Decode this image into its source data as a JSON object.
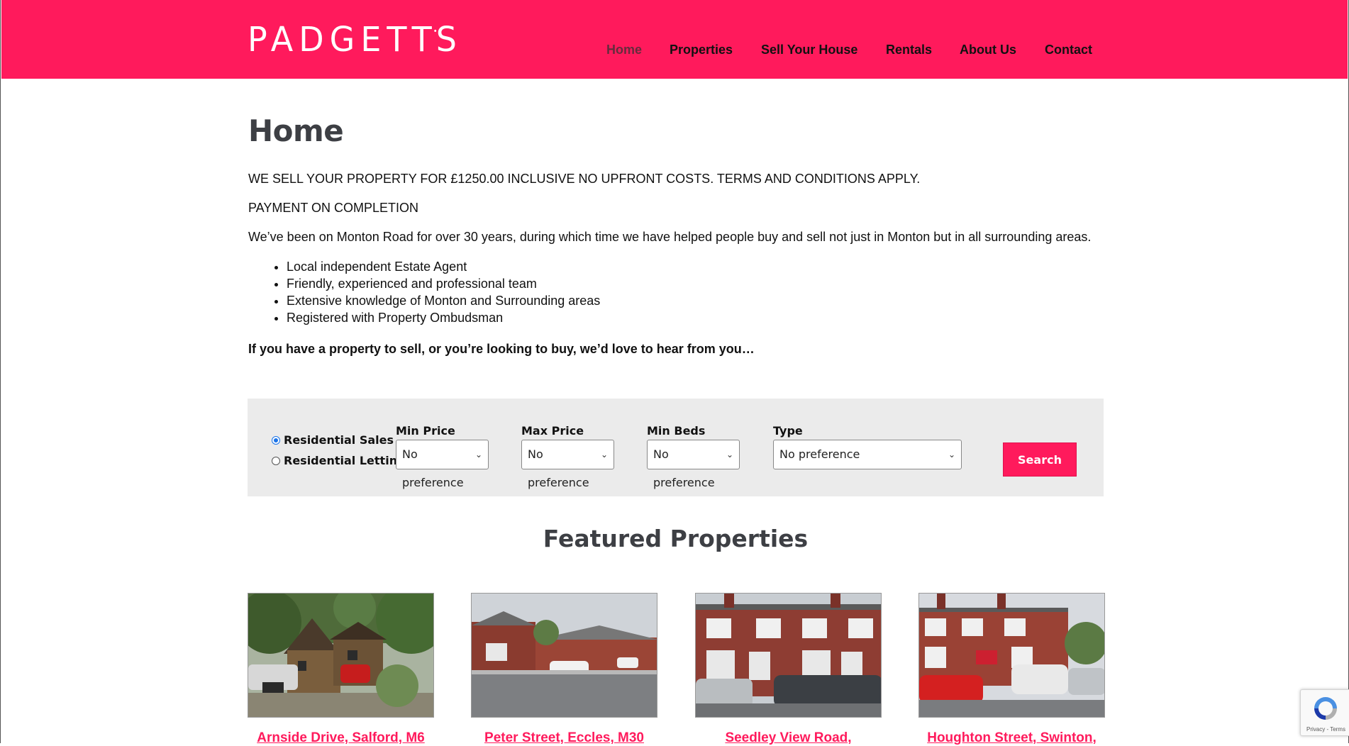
{
  "brand": {
    "logo_left": "PADGETT",
    "logo_dot": "•",
    "logo_right": "S",
    "accent": "#ff1a5c"
  },
  "nav": [
    {
      "label": "Home",
      "active": true
    },
    {
      "label": "Properties"
    },
    {
      "label": "Sell Your House"
    },
    {
      "label": "Rentals"
    },
    {
      "label": "About Us"
    },
    {
      "label": "Contact"
    }
  ],
  "page": {
    "title": "Home",
    "intro1": "WE SELL YOUR PROPERTY FOR £1250.00 INCLUSIVE NO UPFRONT COSTS. TERMS AND CONDITIONS APPLY.",
    "intro2": "PAYMENT ON COMPLETION",
    "intro3": "We’ve been on Monton Road for over 30 years, during which time we have helped people buy and sell not just in Monton but in all surrounding areas.",
    "bullets": [
      "Local independent Estate Agent",
      "Friendly, experienced and professional team",
      "Extensive knowledge of Monton and Surrounding areas",
      "Registered with Property Ombudsman"
    ],
    "cta": "If you have a property to sell, or you’re looking to buy, we’d love to hear from you…"
  },
  "search": {
    "radio_sales": "Residential Sales",
    "radio_lettings": "Residential Lettings",
    "selected": "sales",
    "min_price_label": "Min Price",
    "min_price_value": "No preference",
    "max_price_label": "Max Price",
    "max_price_value": "No preference",
    "min_beds_label": "Min Beds",
    "min_beds_value": "No preference",
    "type_label": "Type",
    "type_value": "No preference",
    "button": "Search"
  },
  "featured": {
    "title": "Featured Properties",
    "cards": [
      {
        "title": "Arnside Drive, Salford, M6"
      },
      {
        "title": "Peter Street, Eccles, M30"
      },
      {
        "title": "Seedley View Road,"
      },
      {
        "title": "Houghton Street, Swinton,"
      }
    ]
  },
  "recaptcha": {
    "footer": "Privacy - Terms"
  }
}
